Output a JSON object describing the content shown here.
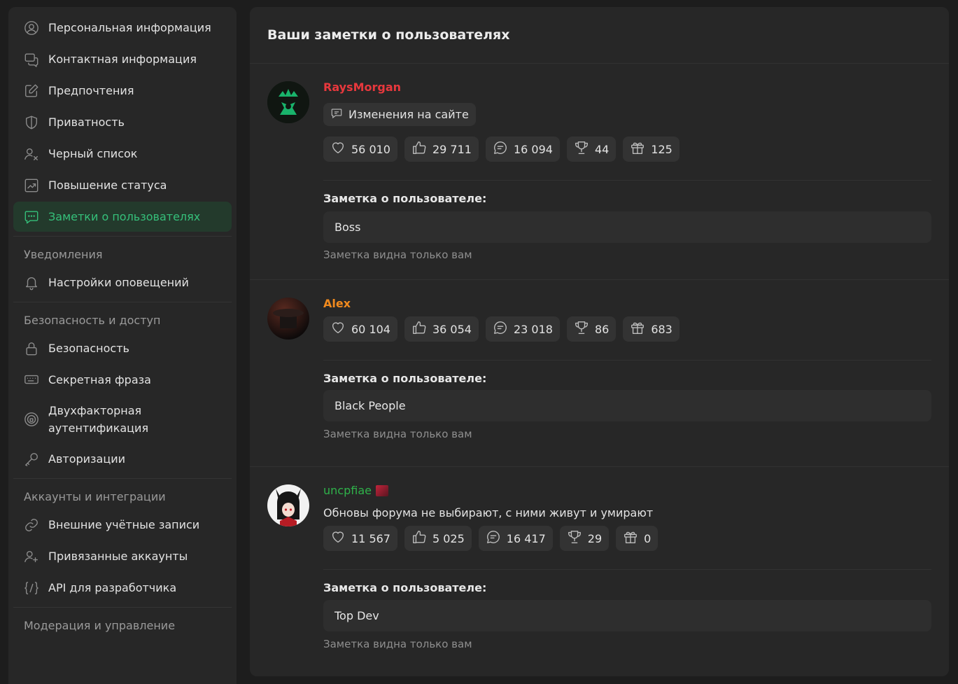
{
  "sidebar": {
    "items_top": [
      {
        "label": "Персональная информация",
        "icon": "user-circle-icon"
      },
      {
        "label": "Контактная информация",
        "icon": "chat-bubbles-icon"
      },
      {
        "label": "Предпочтения",
        "icon": "edit-icon"
      },
      {
        "label": "Приватность",
        "icon": "shield-icon"
      },
      {
        "label": "Черный список",
        "icon": "user-x-icon"
      },
      {
        "label": "Повышение статуса",
        "icon": "chart-up-icon"
      },
      {
        "label": "Заметки о пользователях",
        "icon": "comment-dots-icon"
      }
    ],
    "notifications_heading": "Уведомления",
    "notifications_items": [
      {
        "label": "Настройки оповещений",
        "icon": "bell-icon"
      }
    ],
    "security_heading": "Безопасность и доступ",
    "security_items": [
      {
        "label": "Безопасность",
        "icon": "lock-icon"
      },
      {
        "label": "Секретная фраза",
        "icon": "keyboard-icon"
      },
      {
        "label": "Двухфакторная аутентификация",
        "icon": "two-factor-icon"
      },
      {
        "label": "Авторизации",
        "icon": "key-icon"
      }
    ],
    "accounts_heading": "Аккаунты и интеграции",
    "accounts_items": [
      {
        "label": "Внешние учётные записи",
        "icon": "link-icon"
      },
      {
        "label": "Привязанные аккаунты",
        "icon": "user-plus-icon"
      },
      {
        "label": "API для разработчика",
        "icon": "code-icon"
      }
    ],
    "moderation_heading": "Модерация и управление"
  },
  "main": {
    "title": "Ваши заметки о пользователях",
    "note_label": "Заметка о пользователе:",
    "note_hint": "Заметка видна только вам",
    "users": [
      {
        "name": "RaysMorgan",
        "name_color": "#e8383d",
        "badge": "Изменения на сайте",
        "stats": [
          "56 010",
          "29 711",
          "16 094",
          "44",
          "125"
        ],
        "note": "Boss"
      },
      {
        "name": "Alex",
        "name_color": "#f08a1e",
        "stats": [
          "60 104",
          "36 054",
          "23 018",
          "86",
          "683"
        ],
        "note": "Black People"
      },
      {
        "name": "uncpfiae",
        "name_color": "#2fb24a",
        "status": "Обновы форума не выбирают, с ними живут и умирают",
        "stats": [
          "11 567",
          "5 025",
          "16 417",
          "29",
          "0"
        ],
        "note": "Top Dev"
      }
    ],
    "stat_icons": [
      "heart-icon",
      "thumbs-up-icon",
      "message-icon",
      "trophy-icon",
      "gift-icon"
    ]
  },
  "colors": {
    "accent": "#35c07a",
    "background": "#1d1d1d",
    "panel": "#272727"
  }
}
